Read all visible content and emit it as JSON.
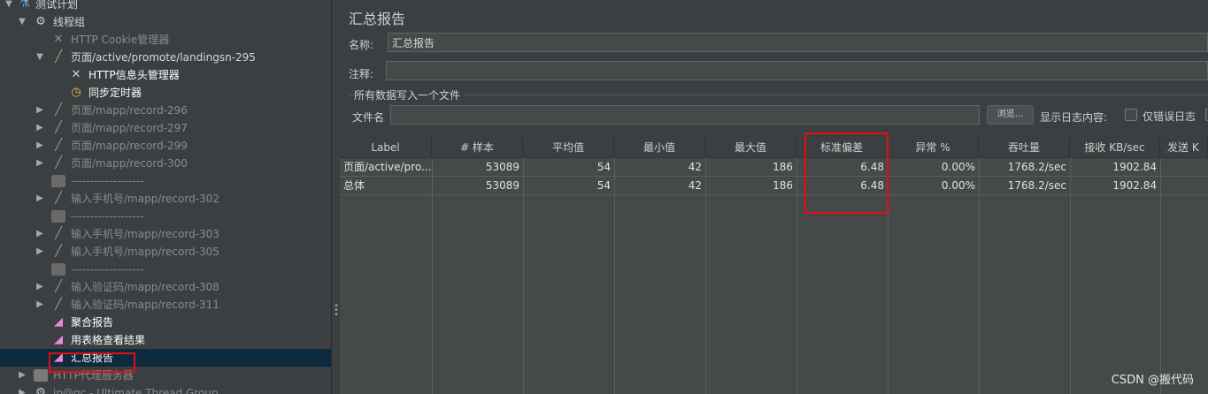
{
  "tree": {
    "items": [
      {
        "label": "测试计划",
        "icon": "flask-icon"
      },
      {
        "label": "线程组",
        "icon": "gear-icon"
      },
      {
        "label": "HTTP Cookie管理器",
        "icon": "wrench-icon"
      },
      {
        "label": "页面/active/promote/landingsn-295",
        "icon": "pipette-icon"
      },
      {
        "label": "HTTP信息头管理器",
        "icon": "wrench-icon"
      },
      {
        "label": "同步定时器",
        "icon": "timer-icon"
      },
      {
        "label": "页面/mapp/record-296",
        "icon": "pipette-icon"
      },
      {
        "label": "页面/mapp/record-297",
        "icon": "pipette-icon"
      },
      {
        "label": "页面/mapp/record-299",
        "icon": "pipette-icon"
      },
      {
        "label": "页面/mapp/record-300",
        "icon": "pipette-icon"
      },
      {
        "label": "-------------------",
        "icon": "block-icon"
      },
      {
        "label": "输入手机号/mapp/record-302",
        "icon": "pipette-icon"
      },
      {
        "label": "-------------------",
        "icon": "block-icon"
      },
      {
        "label": "输入手机号/mapp/record-303",
        "icon": "pipette-icon"
      },
      {
        "label": "输入手机号/mapp/record-305",
        "icon": "pipette-icon"
      },
      {
        "label": "-------------------",
        "icon": "block-icon"
      },
      {
        "label": "输入验证码/mapp/record-308",
        "icon": "pipette-icon"
      },
      {
        "label": "输入验证码/mapp/record-311",
        "icon": "pipette-icon"
      },
      {
        "label": "聚合报告",
        "icon": "chart-icon"
      },
      {
        "label": "用表格查看结果",
        "icon": "chart-icon"
      },
      {
        "label": "汇总报告",
        "icon": "chart-icon"
      },
      {
        "label": "HTTP代理服务器",
        "icon": "proxy-icon"
      },
      {
        "label": "jp@gc - Ultimate Thread Group",
        "icon": "gear-icon"
      }
    ]
  },
  "panel": {
    "title": "汇总报告",
    "name_label": "名称:",
    "name_value": "汇总报告",
    "comment_label": "注释:",
    "comment_value": "",
    "group_title": "所有数据写入一个文件",
    "file_label": "文件名",
    "file_value": "",
    "browse_label": "浏览...",
    "log_label": "显示日志内容:",
    "errors_only_label": "仅错误日志"
  },
  "table": {
    "columns": [
      "Label",
      "# 样本",
      "平均值",
      "最小值",
      "最大值",
      "标准偏差",
      "异常 %",
      "吞吐量",
      "接收 KB/sec",
      "发送 K"
    ],
    "rows": [
      [
        "页面/active/pro...",
        "53089",
        "54",
        "42",
        "186",
        "6.48",
        "0.00%",
        "1768.2/sec",
        "1902.84",
        ""
      ],
      [
        "总体",
        "53089",
        "54",
        "42",
        "186",
        "6.48",
        "0.00%",
        "1768.2/sec",
        "1902.84",
        ""
      ]
    ]
  },
  "watermark": "CSDN @搬代码",
  "colors": {
    "background": "#3c3f41",
    "table_background": "#45494a",
    "selection": "#0d293e",
    "highlight_box": "#e01010"
  }
}
